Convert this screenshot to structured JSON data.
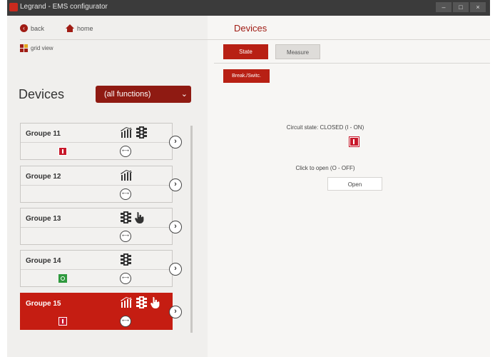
{
  "window": {
    "title": "Legrand - EMS configurator"
  },
  "nav": {
    "back_label": "back",
    "home_label": "home",
    "page_title": "Devices",
    "grid_view_label": "grid view"
  },
  "tabs": [
    {
      "label": "State",
      "active": true
    },
    {
      "label": "Measure",
      "active": false
    }
  ],
  "sub_action": {
    "label": "Break./Switc."
  },
  "devices": {
    "heading": "Devices",
    "filter_value": "(all functions)",
    "groups": [
      {
        "name": "Groupe 11",
        "status": "red",
        "icons": [
          "measure-icon",
          "traffic-light-icon"
        ]
      },
      {
        "name": "Groupe 12",
        "status": "none",
        "icons": [
          "measure-icon"
        ]
      },
      {
        "name": "Groupe 13",
        "status": "none",
        "icons": [
          "traffic-light-icon",
          "hand-icon"
        ]
      },
      {
        "name": "Groupe 14",
        "status": "green",
        "icons": [
          "traffic-light-icon"
        ]
      },
      {
        "name": "Groupe 15",
        "status": "red",
        "icons": [
          "measure-icon",
          "traffic-light-icon",
          "hand-icon"
        ],
        "selected": true
      }
    ]
  },
  "detail": {
    "circuit_state": "Circuit state: CLOSED (I - ON)",
    "click_to_open": "Click to open (O - OFF)",
    "open_button": "Open"
  },
  "colors": {
    "accent": "#b82014",
    "accent_dark": "#8f1a12",
    "status_on": "#c8192b",
    "status_off": "#2f9a3e"
  }
}
